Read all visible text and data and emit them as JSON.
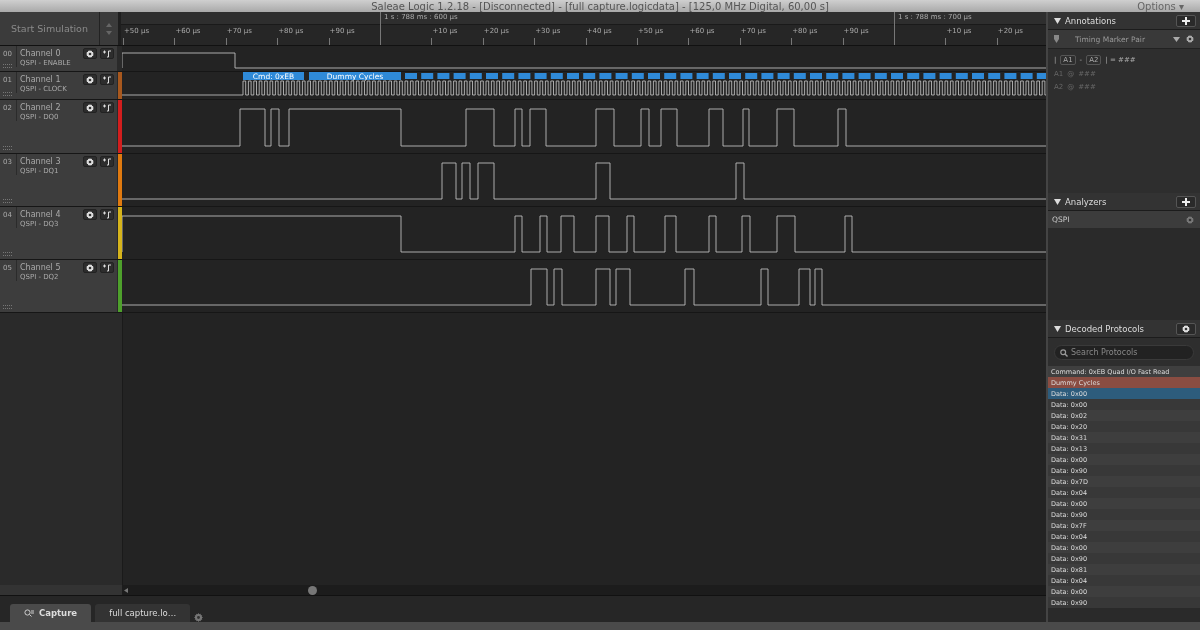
{
  "window": {
    "title": "Saleae Logic 1.2.18 - [Disconnected] - [full capture.logicdata] - [125,0 MHz Digital, 60,00 s]",
    "menu": "Options ▾"
  },
  "toolbar": {
    "start_button": "Start Simulation"
  },
  "ruler": {
    "ticks": [
      {
        "kind": "minor",
        "label": "+50 µs"
      },
      {
        "kind": "minor",
        "label": "+60 µs"
      },
      {
        "kind": "minor",
        "label": "+70 µs"
      },
      {
        "kind": "minor",
        "label": "+80 µs"
      },
      {
        "kind": "minor",
        "label": "+90 µs"
      },
      {
        "kind": "major",
        "label": "1 s : 788 ms : 600 µs"
      },
      {
        "kind": "minor",
        "label": "+10 µs"
      },
      {
        "kind": "minor",
        "label": "+20 µs"
      },
      {
        "kind": "minor",
        "label": "+30 µs"
      },
      {
        "kind": "minor",
        "label": "+40 µs"
      },
      {
        "kind": "minor",
        "label": "+50 µs"
      },
      {
        "kind": "minor",
        "label": "+60 µs"
      },
      {
        "kind": "minor",
        "label": "+70 µs"
      },
      {
        "kind": "minor",
        "label": "+80 µs"
      },
      {
        "kind": "minor",
        "label": "+90 µs"
      },
      {
        "kind": "major",
        "label": "1 s : 788 ms : 700 µs"
      },
      {
        "kind": "minor",
        "label": "+10 µs"
      },
      {
        "kind": "minor",
        "label": "+20 µs"
      }
    ]
  },
  "channels": [
    {
      "number": "00",
      "name": "Channel 0",
      "signal": "QSPI - ENABLE",
      "color": "#2a2a2a"
    },
    {
      "number": "01",
      "name": "Channel 1",
      "signal": "QSPI - CLOCK",
      "color": "#a8581e",
      "decodes": [
        "Cmd: 0xEB",
        "Dummy Cycles"
      ]
    },
    {
      "number": "02",
      "name": "Channel 2",
      "signal": "QSPI - DQ0",
      "color": "#d21e1e"
    },
    {
      "number": "03",
      "name": "Channel 3",
      "signal": "QSPI - DQ1",
      "color": "#e07a10"
    },
    {
      "number": "04",
      "name": "Channel 4",
      "signal": "QSPI - DQ3",
      "color": "#d6b41c"
    },
    {
      "number": "05",
      "name": "Channel 5",
      "signal": "QSPI - DQ2",
      "color": "#4ea02c"
    }
  ],
  "tabs": [
    {
      "label": "Capture",
      "selected": true
    },
    {
      "label": "full capture.lo…",
      "selected": false
    }
  ],
  "annotations": {
    "title": "Annotations",
    "marker": "Timing Marker Pair",
    "formula": [
      "|",
      "A1",
      "-",
      "A2",
      "| = ###"
    ],
    "markers": [
      {
        "name": "A1",
        "at": "@",
        "value": "###"
      },
      {
        "name": "A2",
        "at": "@",
        "value": "###"
      }
    ]
  },
  "analyzers": {
    "title": "Analyzers",
    "items": [
      "QSPI"
    ]
  },
  "decoded": {
    "title": "Decoded Protocols",
    "placeholder": "Search Protocols",
    "rows": [
      {
        "kind": "command",
        "label": "Command: 0xEB Quad I/O Fast Read",
        "selected": false
      },
      {
        "kind": "dummy",
        "label": "Dummy Cycles",
        "selected": false
      },
      {
        "kind": "data",
        "label": "Data: 0x00",
        "selected": true
      },
      {
        "kind": "data",
        "label": "Data: 0x00",
        "selected": false
      },
      {
        "kind": "data",
        "label": "Data: 0x02",
        "selected": false
      },
      {
        "kind": "data",
        "label": "Data: 0x20",
        "selected": false
      },
      {
        "kind": "data",
        "label": "Data: 0x31",
        "selected": false
      },
      {
        "kind": "data",
        "label": "Data: 0x13",
        "selected": false
      },
      {
        "kind": "data",
        "label": "Data: 0x00",
        "selected": false
      },
      {
        "kind": "data",
        "label": "Data: 0x90",
        "selected": false
      },
      {
        "kind": "data",
        "label": "Data: 0x7D",
        "selected": false
      },
      {
        "kind": "data",
        "label": "Data: 0x04",
        "selected": false
      },
      {
        "kind": "data",
        "label": "Data: 0x00",
        "selected": false
      },
      {
        "kind": "data",
        "label": "Data: 0x90",
        "selected": false
      },
      {
        "kind": "data",
        "label": "Data: 0x7F",
        "selected": false
      },
      {
        "kind": "data",
        "label": "Data: 0x04",
        "selected": false
      },
      {
        "kind": "data",
        "label": "Data: 0x00",
        "selected": false
      },
      {
        "kind": "data",
        "label": "Data: 0x90",
        "selected": false
      },
      {
        "kind": "data",
        "label": "Data: 0x81",
        "selected": false
      },
      {
        "kind": "data",
        "label": "Data: 0x04",
        "selected": false
      },
      {
        "kind": "data",
        "label": "Data: 0x00",
        "selected": false
      },
      {
        "kind": "data",
        "label": "Data: 0x90",
        "selected": false
      }
    ]
  }
}
